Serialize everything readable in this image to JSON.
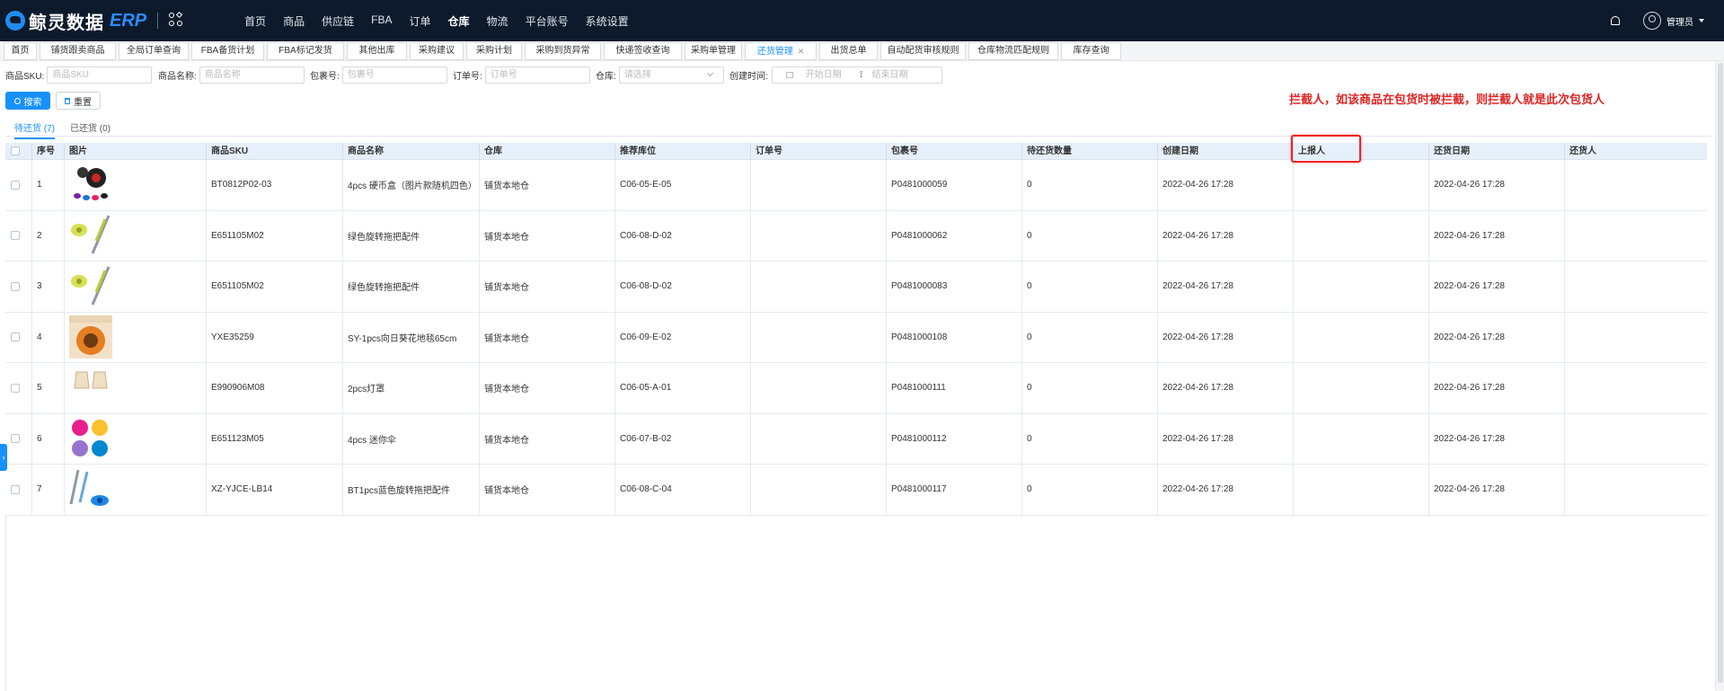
{
  "brand": {
    "name": "鲸灵数据",
    "suffix": "ERP"
  },
  "nav": [
    {
      "label": "首页",
      "active": false
    },
    {
      "label": "商品",
      "active": false
    },
    {
      "label": "供应链",
      "active": false
    },
    {
      "label": "FBA",
      "active": false
    },
    {
      "label": "订单",
      "active": false
    },
    {
      "label": "仓库",
      "active": true
    },
    {
      "label": "物流",
      "active": false
    },
    {
      "label": "平台账号",
      "active": false
    },
    {
      "label": "系统设置",
      "active": false
    }
  ],
  "user": {
    "name": "管理员"
  },
  "tabs": [
    {
      "label": "首页"
    },
    {
      "label": "铺货跟卖商品"
    },
    {
      "label": "全局订单查询"
    },
    {
      "label": "FBA备货计划"
    },
    {
      "label": "FBA标记发货"
    },
    {
      "label": "其他出库"
    },
    {
      "label": "采购建议"
    },
    {
      "label": "采购计划"
    },
    {
      "label": "采购到货异常"
    },
    {
      "label": "快递签收查询"
    },
    {
      "label": "采购单管理"
    },
    {
      "label": "还货管理",
      "active": true,
      "close": "✕"
    },
    {
      "label": "出货总单"
    },
    {
      "label": "自动配货审核规则"
    },
    {
      "label": "仓库物流匹配规则"
    },
    {
      "label": "库存查询"
    }
  ],
  "filters": {
    "sku_label": "商品SKU:",
    "sku_placeholder": "商品SKU",
    "name_label": "商品名称:",
    "name_placeholder": "商品名称",
    "pkg_label": "包裹号:",
    "pkg_placeholder": "包裹号",
    "order_label": "订单号:",
    "order_placeholder": "订单号",
    "wh_label": "仓库:",
    "wh_placeholder": "请选择",
    "created_label": "创建时间:",
    "start_placeholder": "开始日期",
    "end_placeholder": "结束日期",
    "range_sep": "⟟"
  },
  "buttons": {
    "search": "搜索",
    "reset": "重置"
  },
  "annotation": "拦截人，如该商品在包货时被拦截，则拦截人就是此次包货人",
  "subtabs": [
    {
      "label": "待还货 (7)",
      "active": true
    },
    {
      "label": "已还货 (0)",
      "active": false
    }
  ],
  "columns": [
    "序号",
    "图片",
    "商品SKU",
    "商品名称",
    "仓库",
    "推荐库位",
    "订单号",
    "包裹号",
    "待还货数量",
    "创建日期",
    "上报人",
    "还货日期",
    "还货人"
  ],
  "rows": [
    {
      "seq": "1",
      "img": "coin-box",
      "sku": "BT0812P02-03",
      "name": "4pcs 硬币盒（图片款随机四色）",
      "wh": "铺货本地仓",
      "loc": "C06-05-E-05",
      "order": "",
      "pkg": "P0481000059",
      "qty": "0",
      "cdate": "2022-04-26 17:28",
      "reporter": "",
      "rdate": "2022-04-26 17:28",
      "returner": ""
    },
    {
      "seq": "2",
      "img": "mop-green",
      "sku": "E651105M02",
      "name": "绿色旋转拖把配件",
      "wh": "铺货本地仓",
      "loc": "C06-08-D-02",
      "order": "",
      "pkg": "P0481000062",
      "qty": "0",
      "cdate": "2022-04-26 17:28",
      "reporter": "",
      "rdate": "2022-04-26 17:28",
      "returner": ""
    },
    {
      "seq": "3",
      "img": "mop-green",
      "sku": "E651105M02",
      "name": "绿色旋转拖把配件",
      "wh": "铺货本地仓",
      "loc": "C06-08-D-02",
      "order": "",
      "pkg": "P0481000083",
      "qty": "0",
      "cdate": "2022-04-26 17:28",
      "reporter": "",
      "rdate": "2022-04-26 17:28",
      "returner": ""
    },
    {
      "seq": "4",
      "img": "sunflower-rug",
      "sku": "YXE35259",
      "name": "SY-1pcs向日葵花地毯65cm",
      "wh": "铺货本地仓",
      "loc": "C06-09-E-02",
      "order": "",
      "pkg": "P0481000108",
      "qty": "0",
      "cdate": "2022-04-26 17:28",
      "reporter": "",
      "rdate": "2022-04-26 17:28",
      "returner": ""
    },
    {
      "seq": "5",
      "img": "lampshade",
      "sku": "E990906M08",
      "name": "2pcs灯罩",
      "wh": "铺货本地仓",
      "loc": "C06-05-A-01",
      "order": "",
      "pkg": "P0481000111",
      "qty": "0",
      "cdate": "2022-04-26 17:28",
      "reporter": "",
      "rdate": "2022-04-26 17:28",
      "returner": ""
    },
    {
      "seq": "6",
      "img": "umbrellas",
      "sku": "E651123M05",
      "name": "4pcs 迷你伞",
      "wh": "铺货本地仓",
      "loc": "C06-07-B-02",
      "order": "",
      "pkg": "P0481000112",
      "qty": "0",
      "cdate": "2022-04-26 17:28",
      "reporter": "",
      "rdate": "2022-04-26 17:28",
      "returner": ""
    },
    {
      "seq": "7",
      "img": "mop-blue",
      "sku": "XZ-YJCE-LB14",
      "name": "BT1pcs蓝色旋转拖把配件",
      "wh": "铺货本地仓",
      "loc": "C06-08-C-04",
      "order": "",
      "pkg": "P0481000117",
      "qty": "0",
      "cdate": "2022-04-26 17:28",
      "reporter": "",
      "rdate": "2022-04-26 17:28",
      "returner": ""
    }
  ],
  "colors": {
    "topbar": "#0c1a2b",
    "accent": "#1890ff",
    "annotation": "#e02424",
    "header": "#e6f0fb"
  }
}
